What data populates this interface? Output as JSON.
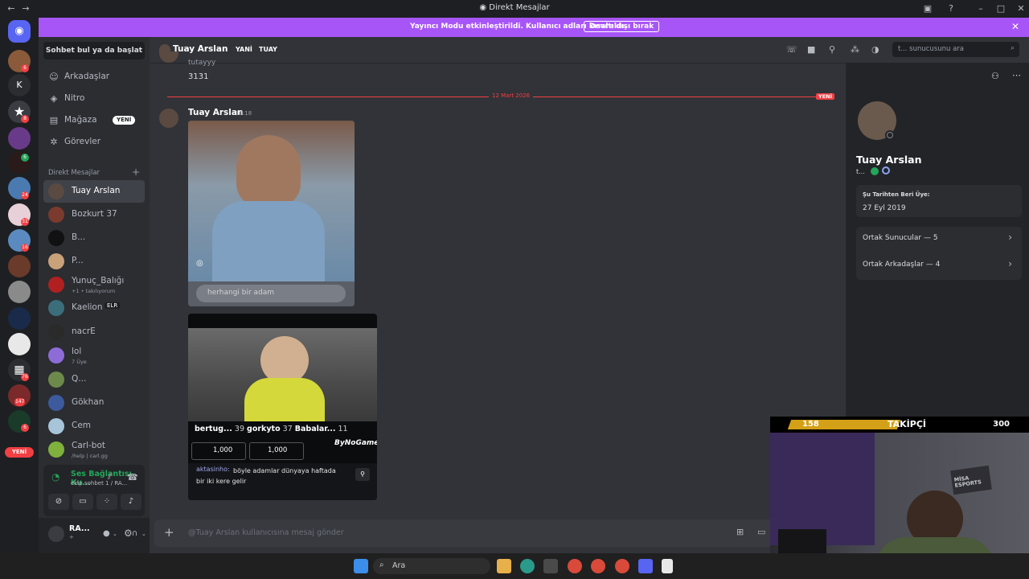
{
  "window": {
    "title": "Direkt Mesajlar"
  },
  "banner": {
    "message": "Yayıncı Modu etkinleştirildi. Kullanıcı adları kısaltıldı.",
    "button": "Devre dışı bırak"
  },
  "server_rail": {
    "dm_logo": "discord-icon",
    "k_label": "K",
    "badges": [
      "6",
      "8",
      "6",
      "24",
      "31",
      "16",
      "76",
      "147",
      "6"
    ],
    "new_label": "YENİ"
  },
  "sidebar": {
    "search_button": "Sohbet bul ya da başlat",
    "nav": [
      {
        "label": "Arkadaşlar",
        "icon": "friends-icon"
      },
      {
        "label": "Nitro",
        "icon": "nitro-icon"
      },
      {
        "label": "Mağaza",
        "icon": "shop-icon",
        "badge": "YENİ"
      },
      {
        "label": "Görevler",
        "icon": "quests-icon"
      }
    ],
    "dm_header": "Direkt Mesajlar",
    "dms": [
      {
        "name": "Tuay Arslan",
        "color": "#5a4a42"
      },
      {
        "name": "Bozkurt 37",
        "color": "#7a3b2e"
      },
      {
        "name": "B...",
        "color": "#111111"
      },
      {
        "name": "P...",
        "color": "#c9a27a"
      },
      {
        "name": "Yunuç_Balığı",
        "sub": "+1 • takılıyorum",
        "color": "#b02020"
      },
      {
        "name": "Kaelion",
        "tag": "ELR",
        "color": "#3b6e7a"
      },
      {
        "name": "nacrE",
        "color": "#2a2a2a"
      },
      {
        "name": "lol",
        "sub": "7 Üye",
        "color": "#8e6cd8"
      },
      {
        "name": "Q...",
        "color": "#6d8a4a"
      },
      {
        "name": "Gökhan",
        "color": "#3d5a9e"
      },
      {
        "name": "Cem",
        "color": "#a8c4d8"
      },
      {
        "name": "Carl-bot",
        "sub": "/help | carl.gg",
        "color": "#7fb13c"
      }
    ],
    "voice": {
      "status": "Ses Bağlantısı Ku...",
      "channel": "ekip sohbet 1 / RA..."
    },
    "user": {
      "name": "RA...",
      "status": "+"
    }
  },
  "chat": {
    "header_name": "Tuay Arslan",
    "header_tag1": "YANİ",
    "header_tag2": "TUAY",
    "search_placeholder": "t... sunucusunu ara",
    "prev_author": "tutayyy",
    "prev_message": "3131",
    "date_divider": "12 Mart 2026",
    "new_label": "YENİ",
    "message": {
      "author": "Tuay Arslan",
      "time": "10:18"
    },
    "image1_search_text": "herhangi bir adam",
    "image2": {
      "users": [
        {
          "name": "bertug...",
          "count": "39"
        },
        {
          "name": "gorkyto",
          "count": "37"
        },
        {
          "name": "Babalar...",
          "count": "11"
        }
      ],
      "pills": [
        "1,000",
        "1,000"
      ],
      "brand": "ByNoGame",
      "comment_user": "aktasinho:",
      "comment_text": "böyle adamlar dünyaya haftada bir iki kere gelir"
    },
    "composer_placeholder": "@Tuay Arslan kullanıcısına mesaj gönder"
  },
  "profile": {
    "name": "Tuay Arslan",
    "status": "t...",
    "member_since_label": "Şu Tarihten Beri Üye:",
    "member_since_value": "27 Eyl 2019",
    "mutual_servers": "Ortak Sunucular — 5",
    "mutual_friends": "Ortak Arkadaşlar — 4"
  },
  "webcam": {
    "left_value": "158",
    "label": "TAKİPÇİ",
    "right_value": "300",
    "wall_logo": "MİSA ESPORTS"
  },
  "taskbar": {
    "search": "Ara"
  }
}
